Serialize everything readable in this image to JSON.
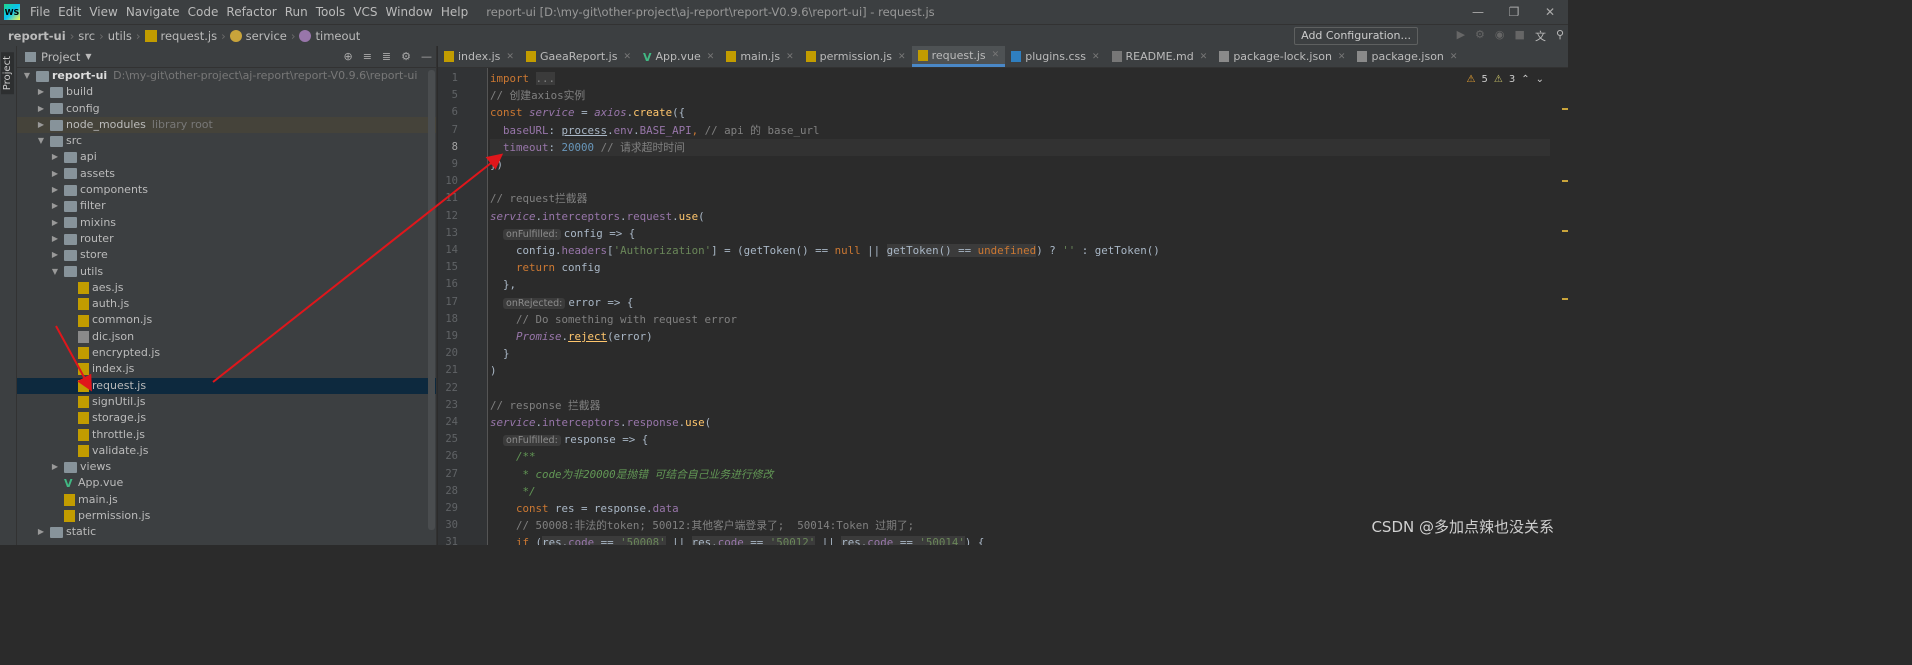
{
  "window": {
    "logo": "WS",
    "title": "report-ui [D:\\my-git\\other-project\\aj-report\\report-V0.9.6\\report-ui] - request.js",
    "menu": [
      "File",
      "Edit",
      "View",
      "Navigate",
      "Code",
      "Refactor",
      "Run",
      "Tools",
      "VCS",
      "Window",
      "Help"
    ]
  },
  "breadcrumb": [
    "report-ui",
    "src",
    "utils",
    "request.js",
    "service",
    "timeout"
  ],
  "toolbar": {
    "add_config": "Add Configuration..."
  },
  "project_panel": {
    "title": "Project",
    "side_label": "Project",
    "root": {
      "name": "report-ui",
      "path": "D:\\my-git\\other-project\\aj-report\\report-V0.9.6\\report-ui"
    },
    "items": [
      {
        "name": "build",
        "type": "folder",
        "depth": 1,
        "expanded": false
      },
      {
        "name": "config",
        "type": "folder",
        "depth": 1,
        "expanded": false
      },
      {
        "name": "node_modules",
        "type": "folder",
        "depth": 1,
        "expanded": false,
        "note": "library root"
      },
      {
        "name": "src",
        "type": "folder",
        "depth": 1,
        "expanded": true
      },
      {
        "name": "api",
        "type": "folder",
        "depth": 2,
        "expanded": false
      },
      {
        "name": "assets",
        "type": "folder",
        "depth": 2,
        "expanded": false
      },
      {
        "name": "components",
        "type": "folder",
        "depth": 2,
        "expanded": false
      },
      {
        "name": "filter",
        "type": "folder",
        "depth": 2,
        "expanded": false
      },
      {
        "name": "mixins",
        "type": "folder",
        "depth": 2,
        "expanded": false
      },
      {
        "name": "router",
        "type": "folder",
        "depth": 2,
        "expanded": false
      },
      {
        "name": "store",
        "type": "folder",
        "depth": 2,
        "expanded": false
      },
      {
        "name": "utils",
        "type": "folder",
        "depth": 2,
        "expanded": true
      },
      {
        "name": "aes.js",
        "type": "js",
        "depth": 3
      },
      {
        "name": "auth.js",
        "type": "js",
        "depth": 3
      },
      {
        "name": "common.js",
        "type": "js",
        "depth": 3
      },
      {
        "name": "dic.json",
        "type": "json",
        "depth": 3
      },
      {
        "name": "encrypted.js",
        "type": "js",
        "depth": 3
      },
      {
        "name": "index.js",
        "type": "js",
        "depth": 3
      },
      {
        "name": "request.js",
        "type": "js",
        "depth": 3,
        "selected": true
      },
      {
        "name": "signUtil.js",
        "type": "js",
        "depth": 3
      },
      {
        "name": "storage.js",
        "type": "js",
        "depth": 3
      },
      {
        "name": "throttle.js",
        "type": "js",
        "depth": 3
      },
      {
        "name": "validate.js",
        "type": "js",
        "depth": 3
      },
      {
        "name": "views",
        "type": "folder",
        "depth": 2,
        "expanded": false
      },
      {
        "name": "App.vue",
        "type": "vue",
        "depth": 2
      },
      {
        "name": "main.js",
        "type": "js",
        "depth": 2
      },
      {
        "name": "permission.js",
        "type": "js",
        "depth": 2
      },
      {
        "name": "static",
        "type": "folder",
        "depth": 1,
        "expanded": false
      }
    ]
  },
  "tabs": [
    {
      "label": "index.js",
      "type": "js"
    },
    {
      "label": "GaeaReport.js",
      "type": "js"
    },
    {
      "label": "App.vue",
      "type": "vue"
    },
    {
      "label": "main.js",
      "type": "js"
    },
    {
      "label": "permission.js",
      "type": "js"
    },
    {
      "label": "request.js",
      "type": "js",
      "active": true
    },
    {
      "label": "plugins.css",
      "type": "css"
    },
    {
      "label": "README.md",
      "type": "md"
    },
    {
      "label": "package-lock.json",
      "type": "json"
    },
    {
      "label": "package.json",
      "type": "json"
    }
  ],
  "inspections": {
    "warnings": "5",
    "weak_warnings": "3"
  },
  "editor": {
    "current_line": "8",
    "lines": [
      {
        "n": "1",
        "html": "<span class='k'>import</span> <span class='c hl'>...</span>"
      },
      {
        "n": "5",
        "html": "<span class='c'>// 创建axios实例</span>"
      },
      {
        "n": "6",
        "html": "<span class='k'>const</span> <span class='ip'>service</span> <span class='v'>=</span> <span class='ip'>axios</span><span class='v'>.</span><span class='f'>create</span><span class='v'>({</span>"
      },
      {
        "n": "7",
        "html": "  <span class='p'>baseURL</span><span class='v'>: </span><span class='v' style='text-decoration:underline'>process</span><span class='v'>.</span><span class='p'>env</span><span class='v'>.</span><span class='p'>BASE_API</span><span class='k'>,</span> <span class='c'>// api 的 base_url</span>"
      },
      {
        "n": "8",
        "html": "  <span class='p'>timeout</span><span class='v'>: </span><span class='n'>20000</span> <span class='c'>// 请求超时时间</span>"
      },
      {
        "n": "9",
        "html": "<span class='v'>})</span>"
      },
      {
        "n": "10",
        "html": ""
      },
      {
        "n": "11",
        "html": "<span class='c'>// request拦截器</span>"
      },
      {
        "n": "12",
        "html": "<span class='ip'>service</span><span class='v'>.</span><span class='p'>interceptors</span><span class='v'>.</span><span class='p'>request</span><span class='v'>.</span><span class='f'>use</span><span class='v'>(</span>"
      },
      {
        "n": "13",
        "html": "  <span class='hint'>onFulfilled:</span><span class='v'>config =&gt; {</span>"
      },
      {
        "n": "14",
        "html": "    <span class='v'>config.</span><span class='p'>headers</span><span class='v'>[</span><span class='s'>'Authorization'</span><span class='v'>] = (getToken() == </span><span class='k'>null</span> <span class='v'>||</span> <span class='v hl'>getToken() == </span><span class='k hl'>undefined</span><span class='v'>) ? </span><span class='s'>''</span> <span class='v'>: getToken()</span>"
      },
      {
        "n": "15",
        "html": "    <span class='k'>return</span> <span class='v'>config</span>"
      },
      {
        "n": "16",
        "html": "  <span class='v'>},</span>"
      },
      {
        "n": "17",
        "html": "  <span class='hint'>onRejected:</span><span class='v'>error =&gt; {</span>"
      },
      {
        "n": "18",
        "html": "    <span class='c'>// Do something with request error</span>"
      },
      {
        "n": "19",
        "html": "    <span class='ip'>Promise</span><span class='v'>.</span><span class='f' style='text-decoration:underline'>reject</span><span class='v'>(error)</span>"
      },
      {
        "n": "20",
        "html": "  <span class='v'>}</span>"
      },
      {
        "n": "21",
        "html": "<span class='v'>)</span>"
      },
      {
        "n": "22",
        "html": ""
      },
      {
        "n": "23",
        "html": "<span class='c'>// response 拦截器</span>"
      },
      {
        "n": "24",
        "html": "<span class='ip'>service</span><span class='v'>.</span><span class='p'>interceptors</span><span class='v'>.</span><span class='p'>response</span><span class='v'>.</span><span class='f'>use</span><span class='v'>(</span>"
      },
      {
        "n": "25",
        "html": "  <span class='hint'>onFulfilled:</span><span class='v'>response =&gt; {</span>"
      },
      {
        "n": "26",
        "html": "    <span class='cd'>/**</span>"
      },
      {
        "n": "27",
        "html": "     <span class='cd'>* code为非20000是抛错 可结合自己业务进行修改</span>"
      },
      {
        "n": "28",
        "html": "     <span class='cd'>*/</span>"
      },
      {
        "n": "29",
        "html": "    <span class='k'>const</span> <span class='v'>res = response.</span><span class='p'>data</span>"
      },
      {
        "n": "30",
        "html": "    <span class='c'>// 50008:非法的token; 50012:其他客户端登录了;  50014:Token 过期了;</span>"
      },
      {
        "n": "31",
        "html": "    <span class='k'>if</span> <span class='v'>(</span><span class='v hl'>res.</span><span class='p hl'>code</span><span class='v hl'> == </span><span class='s hl'>'50008'</span> <span class='v'>||</span> <span class='v hl'>res.</span><span class='p hl'>code</span><span class='v hl'> == </span><span class='s hl'>'50012'</span> <span class='v'>||</span> <span class='v hl'>res.</span><span class='p hl'>code</span><span class='v hl'> == </span><span class='s hl'>'50014'</span><span class='v'>) {</span>"
      }
    ]
  },
  "watermark": "CSDN @多加点辣也没关系",
  "colors": {
    "annotation_arrow": "#e0161b",
    "selection": "#0d293e",
    "accent_tab": "#4a88c7"
  }
}
